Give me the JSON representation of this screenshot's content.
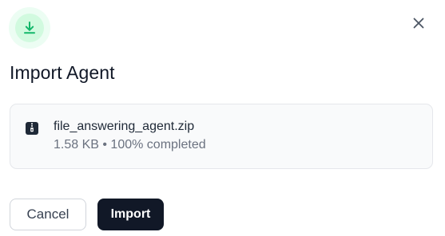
{
  "dialog": {
    "title": "Import Agent",
    "header_icon": "download-icon",
    "close_icon": "close-icon"
  },
  "file": {
    "icon": "zip-file-icon",
    "name": "file_answering_agent.zip",
    "meta": "1.58 KB • 100% completed",
    "progress_percent": 100
  },
  "actions": {
    "cancel_label": "Cancel",
    "import_label": "Import"
  },
  "colors": {
    "accent_green": "#12b76a",
    "icon_ring_outer": "#ecfdf3",
    "icon_ring_inner": "#d1fadf",
    "primary_button": "#111827"
  }
}
